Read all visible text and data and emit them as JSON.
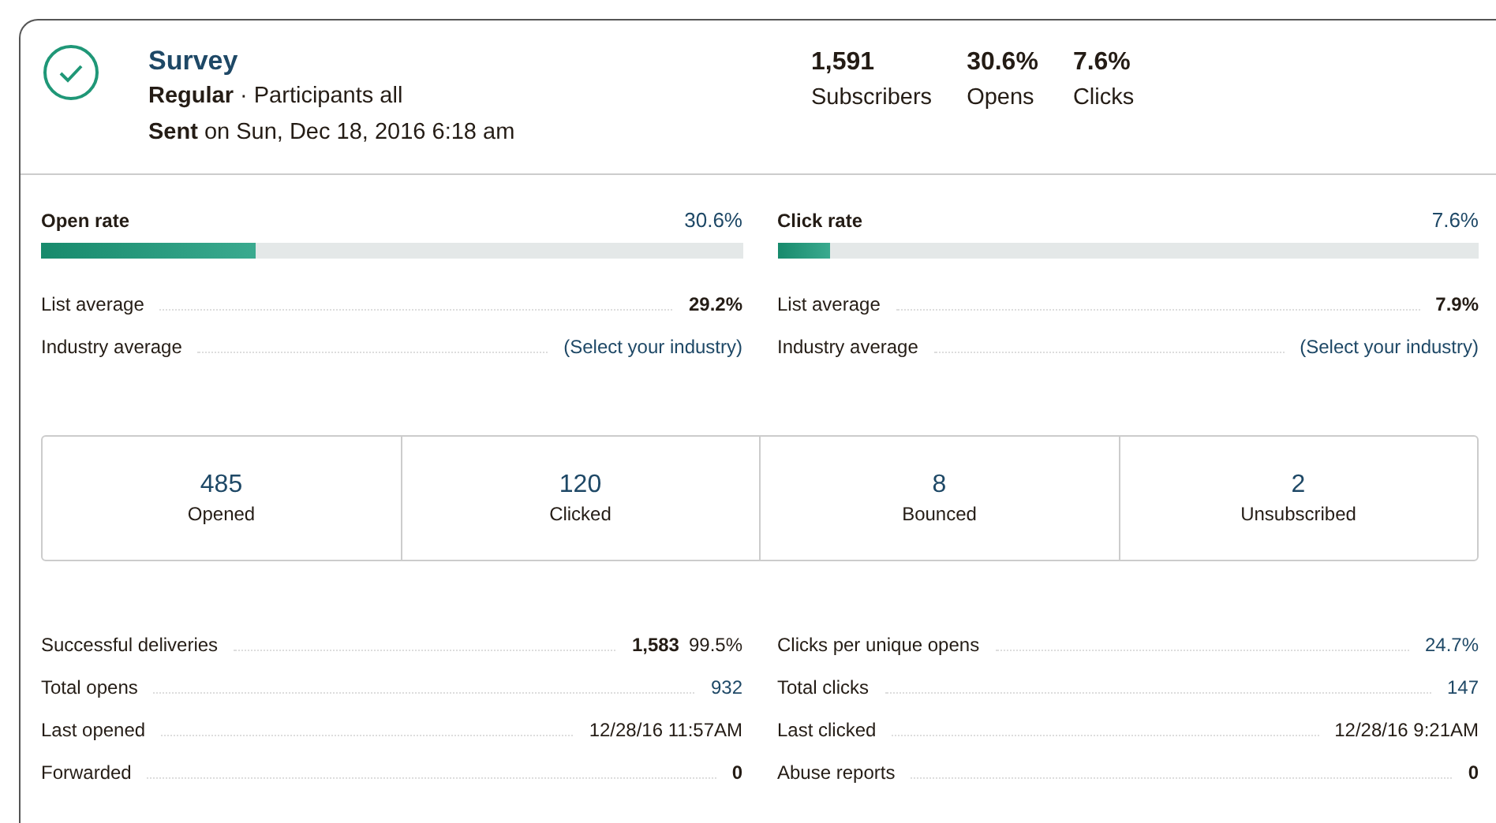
{
  "campaign": {
    "title": "Survey",
    "type_line": "**Regular** · Participants all",
    "sent_line": "**Sent** on Sun, Dec 18, 2016 6:18 am"
  },
  "summary": [
    {
      "value": "1,591",
      "label": "Subscribers"
    },
    {
      "value": "30.6%",
      "label": "Opens"
    },
    {
      "value": "7.6%",
      "label": "Clicks"
    }
  ],
  "rates": [
    {
      "label": "Open rate",
      "reading": "30.6%",
      "level": 0.306,
      "rows": [
        {
          "label": "List average",
          "values": [
            {
              "text": "29.2%",
              "kind": "bold"
            }
          ]
        },
        {
          "label": "Industry average",
          "values": [
            {
              "text": "(Select your industry)",
              "kind": "link"
            }
          ]
        }
      ]
    },
    {
      "label": "Click rate",
      "reading": "7.6%",
      "level": 0.076,
      "rows": [
        {
          "label": "List average",
          "values": [
            {
              "text": "7.9%",
              "kind": "bold"
            }
          ]
        },
        {
          "label": "Industry average",
          "values": [
            {
              "text": "(Select your industry)",
              "kind": "link"
            }
          ]
        }
      ]
    }
  ],
  "counts": [
    {
      "value": "485",
      "label": "Opened"
    },
    {
      "value": "120",
      "label": "Clicked"
    },
    {
      "value": "8",
      "label": "Bounced"
    },
    {
      "value": "2",
      "label": "Unsubscribed"
    }
  ],
  "details": [
    [
      {
        "label": "Successful deliveries",
        "values": [
          {
            "text": "1,583",
            "kind": "bold"
          },
          {
            "text": "99.5%",
            "kind": "plain"
          }
        ]
      },
      {
        "label": "Total opens",
        "values": [
          {
            "text": "932",
            "kind": "link"
          }
        ]
      },
      {
        "label": "Last opened",
        "values": [
          {
            "text": "12/28/16 11:57AM",
            "kind": "plain"
          }
        ]
      },
      {
        "label": "Forwarded",
        "values": [
          {
            "text": "0",
            "kind": "bold"
          }
        ]
      }
    ],
    [
      {
        "label": "Clicks per unique opens",
        "values": [
          {
            "text": "24.7%",
            "kind": "link"
          }
        ]
      },
      {
        "label": "Total clicks",
        "values": [
          {
            "text": "147",
            "kind": "link"
          }
        ]
      },
      {
        "label": "Last clicked",
        "values": [
          {
            "text": "12/28/16 9:21AM",
            "kind": "plain"
          }
        ]
      },
      {
        "label": "Abuse reports",
        "values": [
          {
            "text": "0",
            "kind": "bold"
          }
        ]
      }
    ]
  ]
}
